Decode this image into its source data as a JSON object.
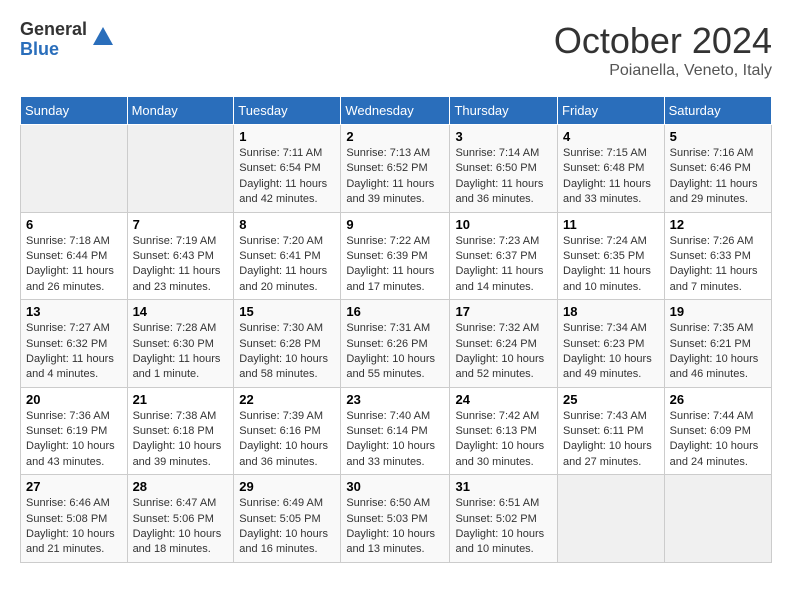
{
  "logo": {
    "general": "General",
    "blue": "Blue"
  },
  "title": "October 2024",
  "location": "Poianella, Veneto, Italy",
  "weekdays": [
    "Sunday",
    "Monday",
    "Tuesday",
    "Wednesday",
    "Thursday",
    "Friday",
    "Saturday"
  ],
  "weeks": [
    [
      {
        "day": "",
        "info": ""
      },
      {
        "day": "",
        "info": ""
      },
      {
        "day": "1",
        "info": "Sunrise: 7:11 AM\nSunset: 6:54 PM\nDaylight: 11 hours and 42 minutes."
      },
      {
        "day": "2",
        "info": "Sunrise: 7:13 AM\nSunset: 6:52 PM\nDaylight: 11 hours and 39 minutes."
      },
      {
        "day": "3",
        "info": "Sunrise: 7:14 AM\nSunset: 6:50 PM\nDaylight: 11 hours and 36 minutes."
      },
      {
        "day": "4",
        "info": "Sunrise: 7:15 AM\nSunset: 6:48 PM\nDaylight: 11 hours and 33 minutes."
      },
      {
        "day": "5",
        "info": "Sunrise: 7:16 AM\nSunset: 6:46 PM\nDaylight: 11 hours and 29 minutes."
      }
    ],
    [
      {
        "day": "6",
        "info": "Sunrise: 7:18 AM\nSunset: 6:44 PM\nDaylight: 11 hours and 26 minutes."
      },
      {
        "day": "7",
        "info": "Sunrise: 7:19 AM\nSunset: 6:43 PM\nDaylight: 11 hours and 23 minutes."
      },
      {
        "day": "8",
        "info": "Sunrise: 7:20 AM\nSunset: 6:41 PM\nDaylight: 11 hours and 20 minutes."
      },
      {
        "day": "9",
        "info": "Sunrise: 7:22 AM\nSunset: 6:39 PM\nDaylight: 11 hours and 17 minutes."
      },
      {
        "day": "10",
        "info": "Sunrise: 7:23 AM\nSunset: 6:37 PM\nDaylight: 11 hours and 14 minutes."
      },
      {
        "day": "11",
        "info": "Sunrise: 7:24 AM\nSunset: 6:35 PM\nDaylight: 11 hours and 10 minutes."
      },
      {
        "day": "12",
        "info": "Sunrise: 7:26 AM\nSunset: 6:33 PM\nDaylight: 11 hours and 7 minutes."
      }
    ],
    [
      {
        "day": "13",
        "info": "Sunrise: 7:27 AM\nSunset: 6:32 PM\nDaylight: 11 hours and 4 minutes."
      },
      {
        "day": "14",
        "info": "Sunrise: 7:28 AM\nSunset: 6:30 PM\nDaylight: 11 hours and 1 minute."
      },
      {
        "day": "15",
        "info": "Sunrise: 7:30 AM\nSunset: 6:28 PM\nDaylight: 10 hours and 58 minutes."
      },
      {
        "day": "16",
        "info": "Sunrise: 7:31 AM\nSunset: 6:26 PM\nDaylight: 10 hours and 55 minutes."
      },
      {
        "day": "17",
        "info": "Sunrise: 7:32 AM\nSunset: 6:24 PM\nDaylight: 10 hours and 52 minutes."
      },
      {
        "day": "18",
        "info": "Sunrise: 7:34 AM\nSunset: 6:23 PM\nDaylight: 10 hours and 49 minutes."
      },
      {
        "day": "19",
        "info": "Sunrise: 7:35 AM\nSunset: 6:21 PM\nDaylight: 10 hours and 46 minutes."
      }
    ],
    [
      {
        "day": "20",
        "info": "Sunrise: 7:36 AM\nSunset: 6:19 PM\nDaylight: 10 hours and 43 minutes."
      },
      {
        "day": "21",
        "info": "Sunrise: 7:38 AM\nSunset: 6:18 PM\nDaylight: 10 hours and 39 minutes."
      },
      {
        "day": "22",
        "info": "Sunrise: 7:39 AM\nSunset: 6:16 PM\nDaylight: 10 hours and 36 minutes."
      },
      {
        "day": "23",
        "info": "Sunrise: 7:40 AM\nSunset: 6:14 PM\nDaylight: 10 hours and 33 minutes."
      },
      {
        "day": "24",
        "info": "Sunrise: 7:42 AM\nSunset: 6:13 PM\nDaylight: 10 hours and 30 minutes."
      },
      {
        "day": "25",
        "info": "Sunrise: 7:43 AM\nSunset: 6:11 PM\nDaylight: 10 hours and 27 minutes."
      },
      {
        "day": "26",
        "info": "Sunrise: 7:44 AM\nSunset: 6:09 PM\nDaylight: 10 hours and 24 minutes."
      }
    ],
    [
      {
        "day": "27",
        "info": "Sunrise: 6:46 AM\nSunset: 5:08 PM\nDaylight: 10 hours and 21 minutes."
      },
      {
        "day": "28",
        "info": "Sunrise: 6:47 AM\nSunset: 5:06 PM\nDaylight: 10 hours and 18 minutes."
      },
      {
        "day": "29",
        "info": "Sunrise: 6:49 AM\nSunset: 5:05 PM\nDaylight: 10 hours and 16 minutes."
      },
      {
        "day": "30",
        "info": "Sunrise: 6:50 AM\nSunset: 5:03 PM\nDaylight: 10 hours and 13 minutes."
      },
      {
        "day": "31",
        "info": "Sunrise: 6:51 AM\nSunset: 5:02 PM\nDaylight: 10 hours and 10 minutes."
      },
      {
        "day": "",
        "info": ""
      },
      {
        "day": "",
        "info": ""
      }
    ]
  ]
}
